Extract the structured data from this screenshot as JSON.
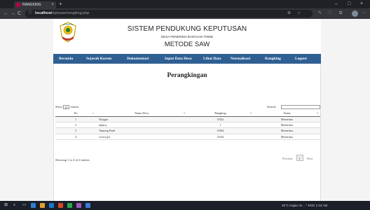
{
  "browser": {
    "tab_title": "RANGKING",
    "tab_close": "×",
    "new_tab": "+",
    "window_controls": [
      "–",
      "□",
      "×"
    ],
    "nav_back": "←",
    "nav_forward": "→",
    "nav_reload": "C",
    "url_host": "localhost",
    "url_path": "/spksaw/rangking.php",
    "toolbar_icons": [
      "star-icon",
      "extensions-icon",
      "bookmarks-icon",
      "profile-icon",
      "menu-icon"
    ]
  },
  "site": {
    "title": "SISTEM PENDUKUNG KEPUTUSAN",
    "subtitle": "DESA PENERIMA BANTUAN TMMD",
    "method": "METODE SAW",
    "accent_color": "#2f5f93"
  },
  "nav": {
    "items": [
      "Beranda",
      "Sejarah Korem",
      "Dokumentasi",
      "Input Data Desa",
      "Lihat Data",
      "Normalisasi",
      "Rangking",
      "Logout"
    ]
  },
  "content": {
    "heading": "Perangkingan",
    "show_label_pre": "Show",
    "show_value": "10",
    "show_label_post": "entries",
    "search_label": "Search:",
    "search_value": "",
    "columns": [
      "No",
      "Nama Desa",
      "Rangking",
      "Status"
    ],
    "rows": [
      {
        "no": "1",
        "nama": "Nyugan",
        "rank": "0.822",
        "status": "Menerima"
      },
      {
        "no": "2",
        "nama": "nnpirq",
        "rank": "1",
        "status": "Menerima"
      },
      {
        "no": "3",
        "nama": "Tanjung Pauh",
        "rank": "0.844",
        "status": "Menerima"
      },
      {
        "no": "4",
        "nama": "wcfrwqcf",
        "rank": "0.644",
        "status": "Menerima"
      }
    ],
    "info": "Showing 1 to 4 of 4 entries",
    "pager": {
      "previous": "Previous",
      "current": "1",
      "next": "Next"
    }
  },
  "taskbar": {
    "tray_text": "25°C Hujan rin...  ^  ENG  1:23 AM"
  }
}
